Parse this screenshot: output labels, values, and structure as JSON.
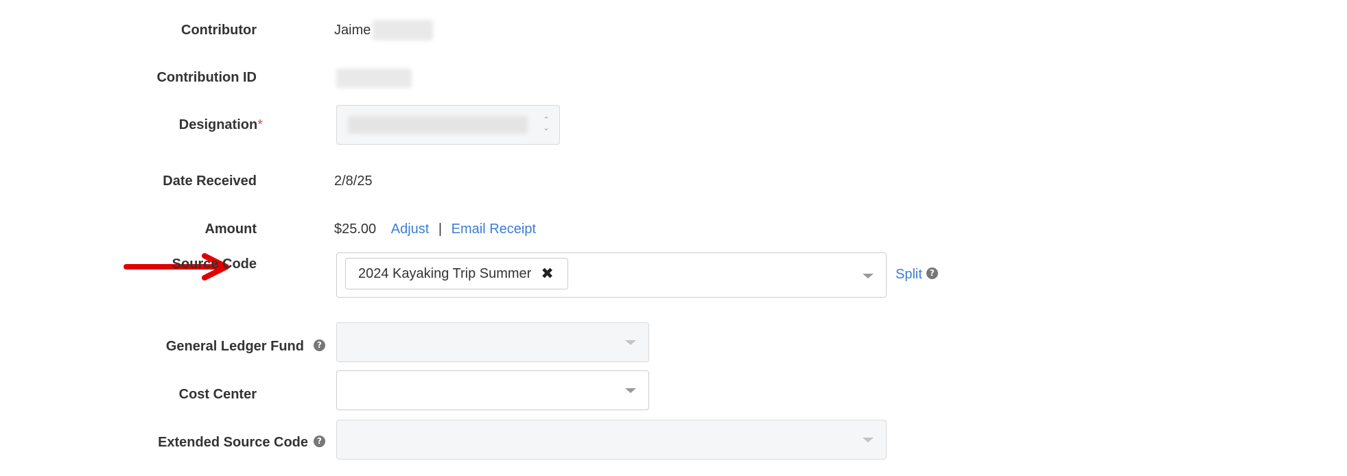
{
  "form": {
    "contributor": {
      "label": "Contributor",
      "value": "Jaime"
    },
    "contribution_id": {
      "label": "Contribution ID"
    },
    "designation": {
      "label": "Designation",
      "required_mark": "*"
    },
    "date_received": {
      "label": "Date Received",
      "value": "2/8/25"
    },
    "amount": {
      "label": "Amount",
      "value": "$25.00",
      "adjust_link": "Adjust",
      "separator": "|",
      "email_receipt_link": "Email Receipt"
    },
    "source_code": {
      "label": "Source Code",
      "selected": "2024 Kayaking Trip Summer",
      "remove_glyph": "✖",
      "split_link": "Split",
      "help_glyph": "?"
    },
    "general_ledger_fund": {
      "label": "General Ledger Fund",
      "help_glyph": "?"
    },
    "cost_center": {
      "label": "Cost Center"
    },
    "extended_source_code": {
      "label": "Extended Source Code",
      "help_glyph": "?"
    }
  },
  "annotation": {
    "arrow_color": "#e00000"
  },
  "colors": {
    "link": "#3b7dd8",
    "required": "#d9534f",
    "help_icon": "#777777"
  }
}
